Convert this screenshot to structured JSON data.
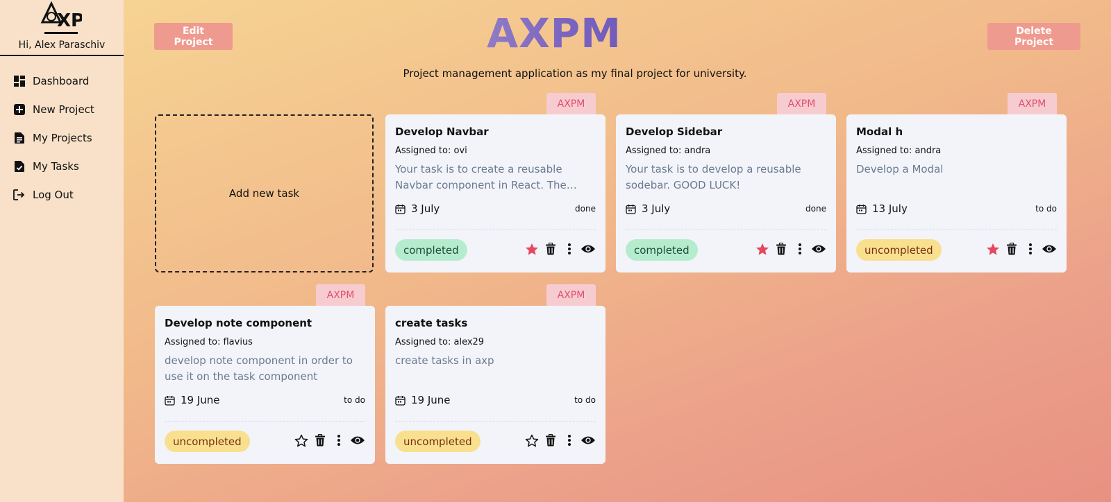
{
  "sidebar": {
    "logo_icon": "axp-management-logo",
    "greeting": "Hi, Alex Paraschiv",
    "items": [
      {
        "label": "Dashboard",
        "icon": "dashboard-icon"
      },
      {
        "label": "New Project",
        "icon": "plus-square-icon"
      },
      {
        "label": "My Projects",
        "icon": "document-icon"
      },
      {
        "label": "My Tasks",
        "icon": "task-file-icon"
      },
      {
        "label": "Log Out",
        "icon": "logout-icon"
      }
    ]
  },
  "header": {
    "edit_label": "Edit Project",
    "delete_label": "Delete Project",
    "title": "AXPM",
    "subtitle": "Project management application as my final project for university."
  },
  "add_task_label": "Add new task",
  "tasks": [
    {
      "tag": "AXPM",
      "title": "Develop Navbar",
      "assigned": "Assigned to: ovi",
      "description": "Your task is to create a reusable Navbar component in React. The component should be responsive.",
      "date": "3 July",
      "status": "done",
      "badge": "completed",
      "favorite": true
    },
    {
      "tag": "AXPM",
      "title": "Develop Sidebar",
      "assigned": "Assigned to: andra",
      "description": "Your task is to develop a reusable sodebar. GOOD LUCK!",
      "date": "3 July",
      "status": "done",
      "badge": "completed",
      "favorite": true
    },
    {
      "tag": "AXPM",
      "title": "Modal h",
      "assigned": "Assigned to: andra",
      "description": "Develop a Modal",
      "date": "13 July",
      "status": "to do",
      "badge": "uncompleted",
      "favorite": true
    },
    {
      "tag": "AXPM",
      "title": "Develop note component",
      "assigned": "Assigned to: flavius",
      "description": "develop note component in order to use it on the task component",
      "date": "19 June",
      "status": "to do",
      "badge": "uncompleted",
      "favorite": false
    },
    {
      "tag": "AXPM",
      "title": "create tasks",
      "assigned": "Assigned to: alex29",
      "description": "create tasks in axp",
      "date": "19 June",
      "status": "to do",
      "badge": "uncompleted",
      "favorite": false
    }
  ],
  "colors": {
    "accent_title": "#7a65c1",
    "tag_text": "#e04f6d",
    "star_active": "#e5485e",
    "completed_bg": "#b6ecce",
    "uncompleted_bg": "#f8e08f",
    "top_button_bg": "#ef9a8e"
  }
}
